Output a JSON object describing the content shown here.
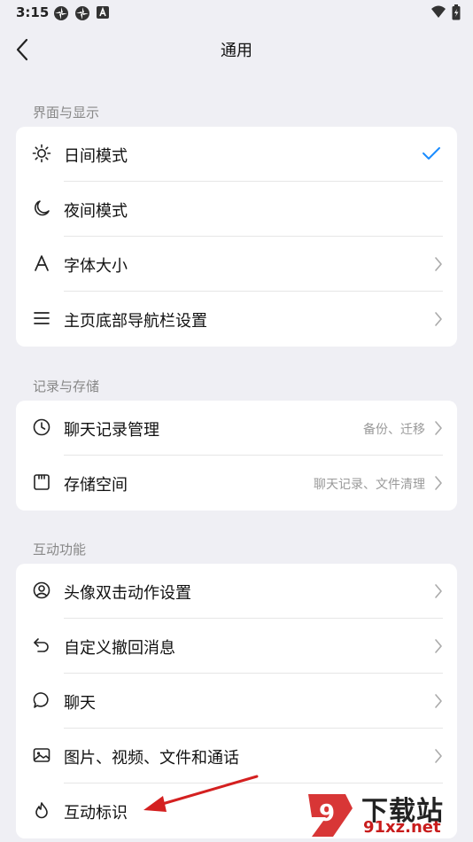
{
  "status_bar": {
    "time": "3:15"
  },
  "header": {
    "title": "通用"
  },
  "sections": [
    {
      "title": "界面与显示",
      "items": [
        {
          "label": "日间模式",
          "icon": "sun-icon",
          "trailing": "check"
        },
        {
          "label": "夜间模式",
          "icon": "moon-icon"
        },
        {
          "label": "字体大小",
          "icon": "font-size-icon",
          "trailing": "chevron"
        },
        {
          "label": "主页底部导航栏设置",
          "icon": "menu-lines-icon",
          "trailing": "chevron"
        }
      ]
    },
    {
      "title": "记录与存储",
      "items": [
        {
          "label": "聊天记录管理",
          "icon": "clock-icon",
          "value": "备份、迁移",
          "trailing": "chevron"
        },
        {
          "label": "存储空间",
          "icon": "sd-card-icon",
          "value": "聊天记录、文件清理",
          "trailing": "chevron"
        }
      ]
    },
    {
      "title": "互动功能",
      "items": [
        {
          "label": "头像双击动作设置",
          "icon": "avatar-circle-icon",
          "trailing": "chevron"
        },
        {
          "label": "自定义撤回消息",
          "icon": "undo-icon",
          "trailing": "chevron"
        },
        {
          "label": "聊天",
          "icon": "chat-bubble-icon",
          "trailing": "chevron"
        },
        {
          "label": "图片、视频、文件和通话",
          "icon": "image-icon",
          "trailing": "chevron"
        },
        {
          "label": "互动标识",
          "icon": "flame-icon"
        }
      ]
    }
  ],
  "watermark": {
    "line1": "下载站",
    "line2": "91xz.net",
    "logo_text": "9",
    "color": "#d42020"
  },
  "colors": {
    "accent": "#1a8cff",
    "background": "#efeff4",
    "arrow": "#d42020"
  }
}
